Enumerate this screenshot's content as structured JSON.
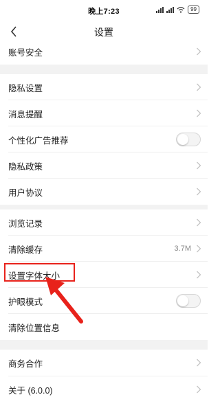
{
  "status_bar": {
    "time": "晚上7:23",
    "battery": "99"
  },
  "header": {
    "title": "设置"
  },
  "settings": {
    "account_security": "账号安全",
    "privacy_settings": "隐私设置",
    "message_reminder": "消息提醒",
    "personalized_ads": "个性化广告推荐",
    "privacy_policy": "隐私政策",
    "user_agreement": "用户协议",
    "browse_history": "浏览记录",
    "clear_cache": "清除缓存",
    "cache_size": "3.7M",
    "font_size": "设置字体大小",
    "eye_protection": "护眼模式",
    "clear_location": "清除位置信息",
    "business_cooperation": "商务合作",
    "about": "关于 (6.0.0)"
  },
  "toggles": {
    "personalized_ads_on": false,
    "eye_protection_on": false
  },
  "colors": {
    "highlight": "#e8221b",
    "section_gap": "#f2f2f2"
  },
  "icons": [
    "back-arrow-icon",
    "chevron-right-icon",
    "wifi-icon",
    "signal-icon",
    "battery-icon"
  ]
}
